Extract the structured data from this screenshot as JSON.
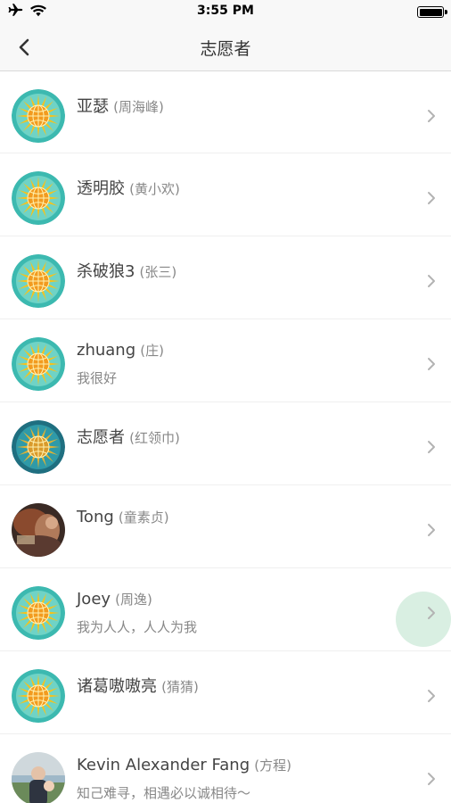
{
  "status_bar": {
    "time": "3:55 PM",
    "icons": [
      "airplane-icon",
      "wifi-icon",
      "battery-icon"
    ]
  },
  "nav": {
    "title": "志愿者",
    "back_icon": "chevron-left-icon"
  },
  "volunteers": [
    {
      "name": "亚瑟",
      "alias": "(周海峰)",
      "subtitle": "",
      "avatar": "sun-badge-icon"
    },
    {
      "name": "透明胶",
      "alias": "(黄小欢)",
      "subtitle": "",
      "avatar": "sun-badge-icon"
    },
    {
      "name": "杀破狼3",
      "alias": "(张三)",
      "subtitle": "",
      "avatar": "sun-badge-icon"
    },
    {
      "name": "zhuang",
      "alias": "(庄)",
      "subtitle": "我很好",
      "avatar": "sun-badge-icon"
    },
    {
      "name": "志愿者",
      "alias": "(红领巾)",
      "subtitle": "",
      "avatar": "sun-badge-dark-icon"
    },
    {
      "name": "Tong",
      "alias": "(童素贞)",
      "subtitle": "",
      "avatar": "user-photo"
    },
    {
      "name": "Joey",
      "alias": "(周逸)",
      "subtitle": "我为人人，人人为我",
      "avatar": "sun-badge-icon"
    },
    {
      "name": "诸葛嗷嗷亮",
      "alias": "(猜猜)",
      "subtitle": "",
      "avatar": "sun-badge-icon"
    },
    {
      "name": "Kevin Alexander Fang",
      "alias": "(方程)",
      "subtitle": "知己难寻，相遇必以诚相待～",
      "avatar": "user-photo"
    }
  ],
  "colors": {
    "badge_teal": "#3cb9b0",
    "badge_sun": "#f6c21b",
    "ripple": "#d9efe2",
    "chevron": "#b3b3b3"
  }
}
